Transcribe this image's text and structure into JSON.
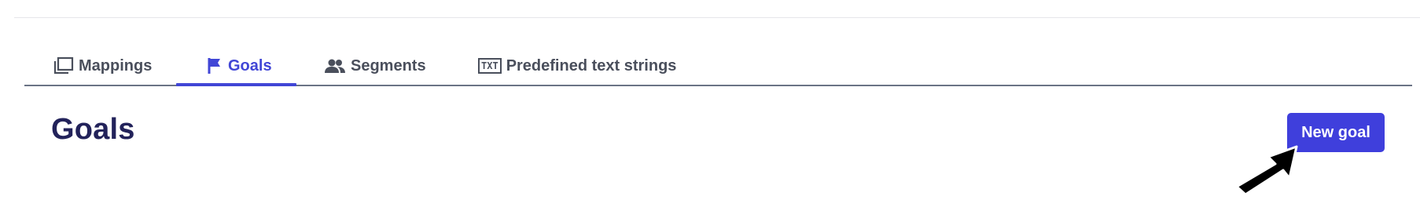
{
  "tabs": [
    {
      "label": "Mappings",
      "icon": "window-stack-icon",
      "active": false
    },
    {
      "label": "Goals",
      "icon": "flag-icon",
      "active": true
    },
    {
      "label": "Segments",
      "icon": "people-icon",
      "active": false
    },
    {
      "label": "Predefined text strings",
      "icon": "txt-icon",
      "active": false
    }
  ],
  "page": {
    "title": "Goals",
    "new_button_label": "New goal"
  },
  "txt_icon_text": "TXT",
  "colors": {
    "accent": "#3f3fdc",
    "active_tab": "#4146d6",
    "title": "#22225a",
    "tab_text": "#4a4f5c"
  }
}
